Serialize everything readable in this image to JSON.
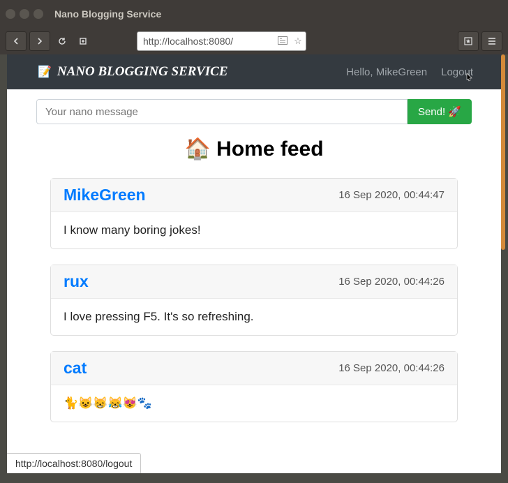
{
  "window": {
    "title": "Nano Blogging Service"
  },
  "browser": {
    "url": "http://localhost:8080/",
    "status_url": "http://localhost:8080/logout"
  },
  "navbar": {
    "brand_emoji": "📝",
    "brand_text": "NANO BLOGGING SERVICE",
    "greeting": "Hello, MikeGreen",
    "logout": "Logout"
  },
  "compose": {
    "placeholder": "Your nano message",
    "send_label": "Send! 🚀"
  },
  "feed": {
    "title": "🏠 Home feed",
    "posts": [
      {
        "author": "MikeGreen",
        "time": "16 Sep 2020, 00:44:47",
        "body": "I know many boring jokes!"
      },
      {
        "author": "rux",
        "time": "16 Sep 2020, 00:44:26",
        "body": "I love pressing F5. It's so refreshing."
      },
      {
        "author": "cat",
        "time": "16 Sep 2020, 00:44:26",
        "body": "🐈😺😸😹😻🐾"
      }
    ]
  }
}
